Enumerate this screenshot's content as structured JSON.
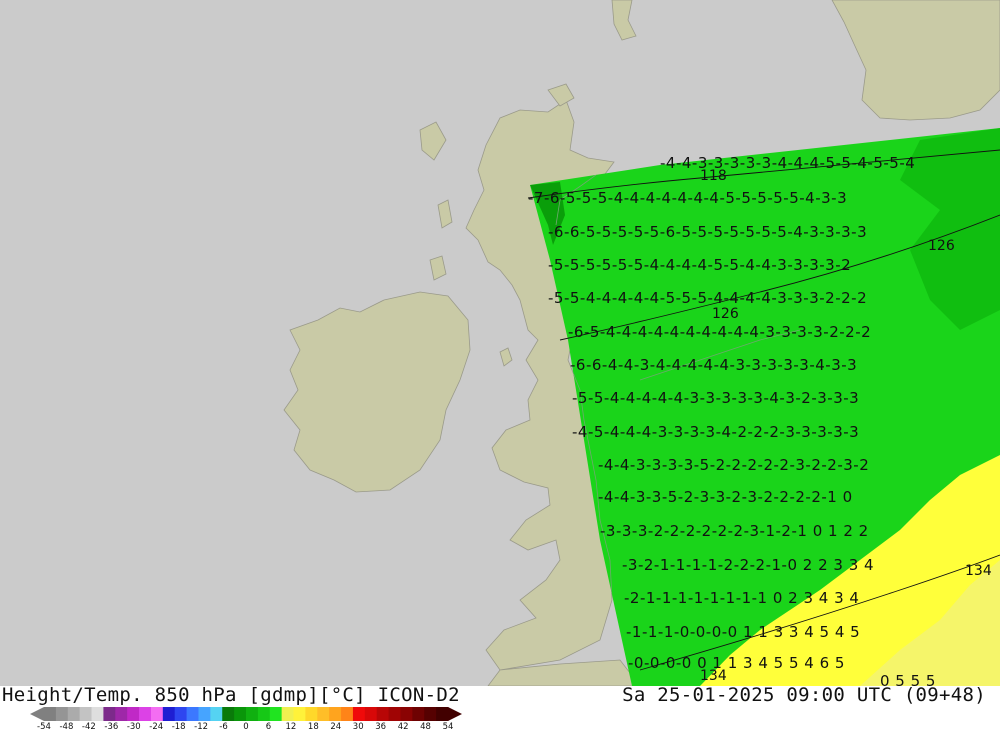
{
  "title_left": "Height/Temp. 850 hPa [gdmp][°C] ICON-D2",
  "title_right": "Sa 25-01-2025 09:00 UTC (09+48)",
  "colors": {
    "sea": "#cbcbcb",
    "land": "#c9caa6",
    "coast": "#9a9a8a",
    "green_bright": "#1ad41a",
    "green_mid": "#10be10",
    "green_dark": "#0a9e0a",
    "yellow": "#ffff3a",
    "yellow_light": "#f5f56a"
  },
  "scale": {
    "colors": [
      "#808080",
      "#959595",
      "#ababab",
      "#c3c3c3",
      "#dedede",
      "#7c2a8a",
      "#9e28a8",
      "#c029c6",
      "#dc42e6",
      "#f46df2",
      "#1e1ed2",
      "#2e46f0",
      "#3c78ff",
      "#46a4ff",
      "#55d3f2",
      "#0a7a0a",
      "#0a960a",
      "#10b010",
      "#16c816",
      "#20e420",
      "#f0f050",
      "#fff23a",
      "#ffd82a",
      "#ffbe28",
      "#ffa41e",
      "#ff8418",
      "#f00a0a",
      "#d80808",
      "#b80606",
      "#a00404",
      "#8a0303",
      "#6e0202",
      "#560101",
      "#420000"
    ],
    "labels": [
      "-54",
      "-48",
      "-42",
      "-36",
      "-30",
      "-24",
      "-18",
      "-12",
      "-6",
      "0",
      "6",
      "12",
      "18",
      "24",
      "30",
      "36",
      "42",
      "48",
      "54"
    ]
  },
  "contour_labels": [
    "118",
    "126",
    "126",
    "134",
    "134"
  ],
  "temp_rows": [
    "-4-4-3-3-3-3-3-4-4-4-5-5-4-5-5-4",
    "-7-6-5-5-5-4-4-4-4-4-4-4-5-5-5-5-5-4-3-3",
    "-6-6-5-5-5-5-5-6-5-5-5-5-5-5-5-4-3-3-3-3",
    "-5-5-5-5-5-5-4-4-4-4-5-5-4-4-3-3-3-3-2",
    "-5-5-4-4-4-4-4-5-5-5-4-4-4-4-3-3-3-2-2-2",
    "-6-5-4-4-4-4-4-4-4-4-4-4-3-3-3-3-2-2-2",
    "-6-6-4-4-3-4-4-4-4-4-3-3-3-3-3-4-3-3",
    "-5-5-4-4-4-4-4-3-3-3-3-3-4-3-2-3-3-3",
    "-4-5-4-4-4-3-3-3-3-4-2-2-2-3-3-3-3-3",
    "-4-4-3-3-3-3-5-2-2-2-2-2-3-2-2-3-2",
    "-4-4-3-3-5-2-3-3-2-3-2-2-2-2-1 0",
    "-3-3-3-2-2-2-2-2-2-3-1-2-1 0 1 2 2",
    "-3-2-1-1-1-1-2-2-2-1-0 2 2 3 3 4",
    "-2-1-1-1-1-1-1-1-1 0 2 3 4 3 4",
    "-1-1-1-0-0-0-0 1 1 3 3 4 5 4 5",
    "-0-0-0-0 0 1 1 3 4 5 5 4 6 5",
    "0 5 5 5"
  ]
}
